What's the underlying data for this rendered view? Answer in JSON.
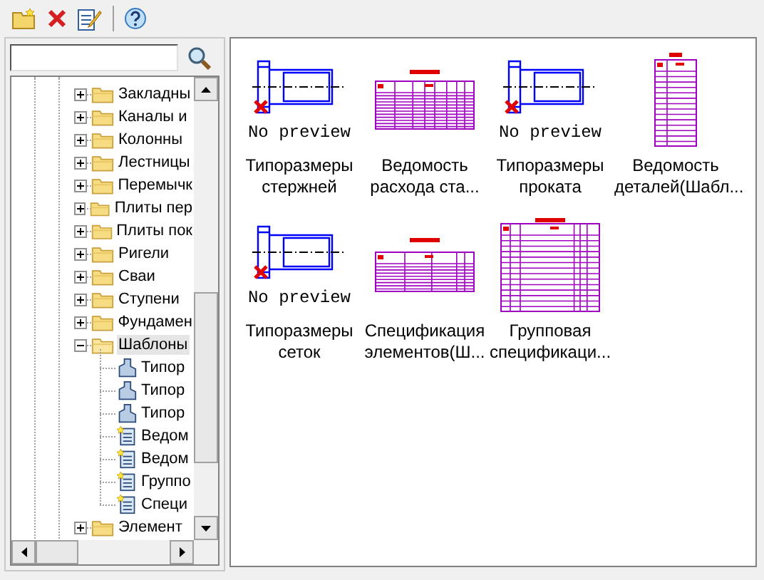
{
  "tree": [
    {
      "label": "Закладны",
      "kind": "folder",
      "expanded": false,
      "selected": false
    },
    {
      "label": "Каналы и",
      "kind": "folder",
      "expanded": false,
      "selected": false
    },
    {
      "label": "Колонны",
      "kind": "folder",
      "expanded": false,
      "selected": false
    },
    {
      "label": "Лестницы",
      "kind": "folder",
      "expanded": false,
      "selected": false
    },
    {
      "label": "Перемычк",
      "kind": "folder",
      "expanded": false,
      "selected": false
    },
    {
      "label": "Плиты пер",
      "kind": "folder",
      "expanded": false,
      "selected": false
    },
    {
      "label": "Плиты пок",
      "kind": "folder",
      "expanded": false,
      "selected": false
    },
    {
      "label": "Ригели",
      "kind": "folder",
      "expanded": false,
      "selected": false
    },
    {
      "label": "Сваи",
      "kind": "folder",
      "expanded": false,
      "selected": false
    },
    {
      "label": "Ступени",
      "kind": "folder",
      "expanded": false,
      "selected": false
    },
    {
      "label": "Фундамен",
      "kind": "folder",
      "expanded": false,
      "selected": false
    },
    {
      "label": "Шаблоны",
      "kind": "folder",
      "expanded": true,
      "selected": true,
      "children": [
        {
          "label": "Типор",
          "kind": "part",
          "selected": false
        },
        {
          "label": "Типор",
          "kind": "part",
          "selected": false
        },
        {
          "label": "Типор",
          "kind": "part",
          "selected": false
        },
        {
          "label": "Ведом",
          "kind": "sheet",
          "selected": false
        },
        {
          "label": "Ведом",
          "kind": "sheet",
          "selected": false
        },
        {
          "label": "Группо",
          "kind": "sheet",
          "selected": false
        },
        {
          "label": "Специ",
          "kind": "sheet",
          "selected": false
        }
      ]
    },
    {
      "label": "Элемент",
      "kind": "folder",
      "expanded": false,
      "selected": false
    }
  ],
  "items": [
    {
      "label": "Типоразмеры стержней",
      "kind": "no-preview",
      "preview_text": "No preview"
    },
    {
      "label": "Ведомость расхода ста...",
      "kind": "wide-table"
    },
    {
      "label": "Типоразмеры проката",
      "kind": "no-preview",
      "preview_text": "No preview"
    },
    {
      "label": "Ведомость деталей(Шабл...",
      "kind": "tall-table"
    },
    {
      "label": "Типоразмеры сеток",
      "kind": "no-preview",
      "preview_text": "No preview"
    },
    {
      "label": "Спецификация элементов(Ш...",
      "kind": "spec-table"
    },
    {
      "label": "Групповая спецификаци...",
      "kind": "group-table"
    }
  ]
}
